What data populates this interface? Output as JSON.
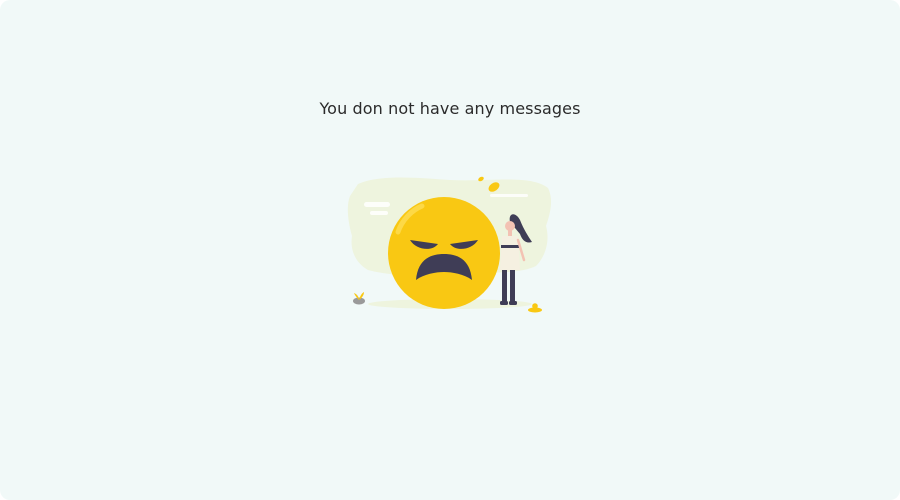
{
  "empty_state": {
    "message": "You don not have any messages",
    "illustration": "sad-emoji-woman-illustration"
  },
  "colors": {
    "background": "#f1f9f8",
    "emoji_yellow": "#f9c813",
    "dark": "#3f3d56",
    "blob": "#eef4de"
  }
}
